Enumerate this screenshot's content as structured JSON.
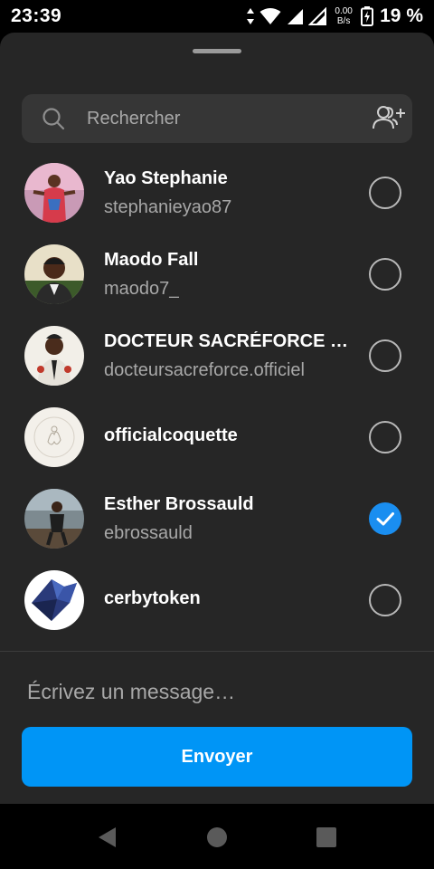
{
  "status_bar": {
    "time": "23:39",
    "net_speed_value": "0.00",
    "net_speed_unit": "B/s",
    "battery": "19 %"
  },
  "search": {
    "placeholder": "Rechercher"
  },
  "contacts": [
    {
      "name": "Yao Stephanie",
      "username": "stephanieyao87",
      "selected": false
    },
    {
      "name": "Maodo Fall",
      "username": "maodo7_",
      "selected": false
    },
    {
      "name": "DOCTEUR SACRÉFORCE …",
      "username": "docteursacreforce.officiel",
      "selected": false
    },
    {
      "name": "officialcoquette",
      "username": "",
      "selected": false
    },
    {
      "name": "Esther Brossauld",
      "username": "ebrossauld",
      "selected": true
    },
    {
      "name": "cerbytoken",
      "username": "",
      "selected": false
    }
  ],
  "message": {
    "placeholder": "Écrivez un message…"
  },
  "send_label": "Envoyer",
  "colors": {
    "sheet_bg": "#262626",
    "accent": "#0095f6",
    "check": "#1a8ef0"
  }
}
